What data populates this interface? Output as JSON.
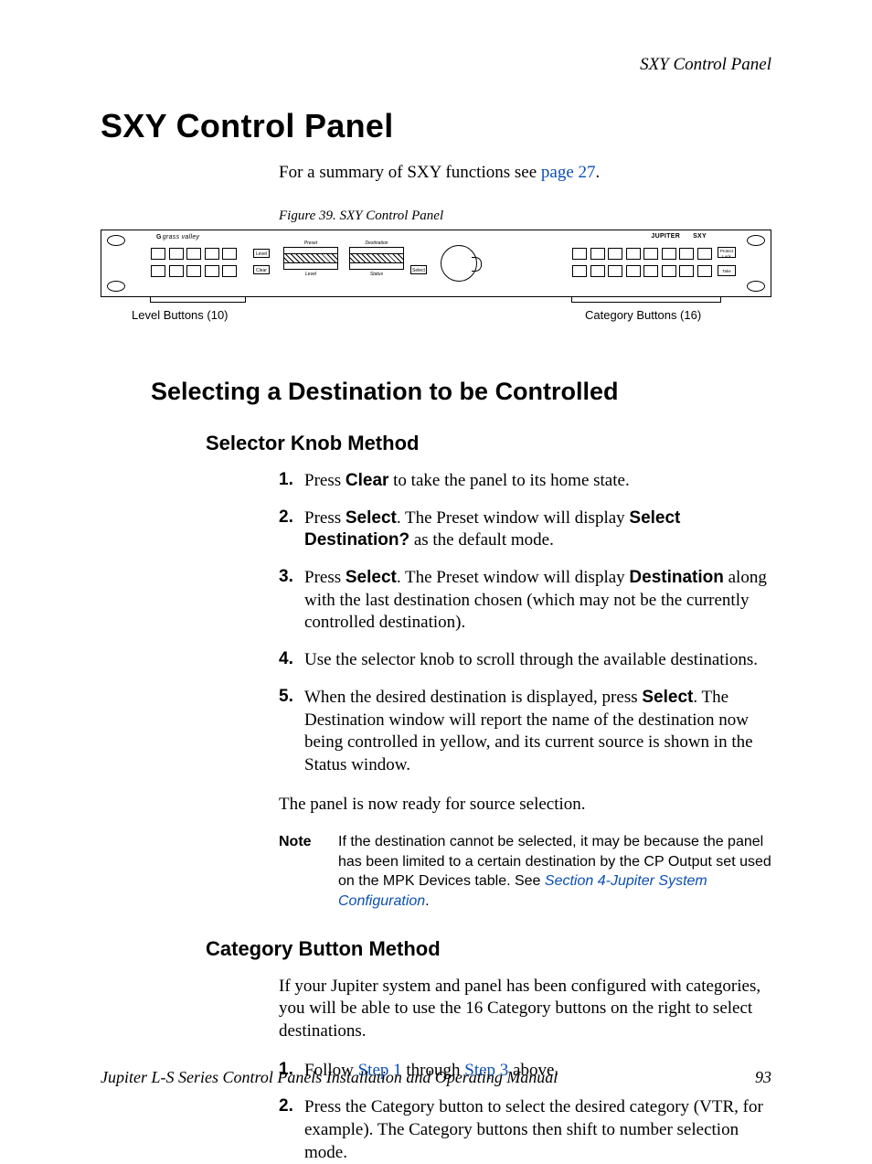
{
  "running_head": "SXY Control Panel",
  "title": "SXY Control Panel",
  "intro_before": "For a summary of SXY functions see ",
  "intro_link": "page 27",
  "intro_after": ".",
  "figure_caption": "Figure 39.  SXY Control Panel",
  "panel": {
    "logo": "grass valley",
    "brand1": "JUPITER",
    "brand2": "SXY",
    "level_btn": "Level",
    "clear_btn": "Clear",
    "select_btn": "Select",
    "preset_label_top": "Preset",
    "dest_label_top": "Destination",
    "preset_label_bot": "Level",
    "dest_label_bot": "Status",
    "protect_btn": "Protect Lock",
    "take_btn": "Take"
  },
  "callout_left": "Level Buttons (10)",
  "callout_right": "Category Buttons (16)",
  "h2": "Selecting a Destination to be Controlled",
  "h3a": "Selector Knob Method",
  "steps_a": [
    {
      "n": "1.",
      "pre": "Press ",
      "bold": "Clear",
      "post": " to take the panel to its home state."
    },
    {
      "n": "2.",
      "pre": "Press ",
      "bold": "Select",
      "mid": ". The Preset window will display ",
      "bold2": "Select Destination?",
      "post": " as the default mode."
    },
    {
      "n": "3.",
      "pre": "Press ",
      "bold": "Select",
      "mid": ". The Preset window will display ",
      "bold2": "Destination",
      "post": " along with the last destination chosen (which may not be the currently controlled destination)."
    },
    {
      "n": "4.",
      "pre": "Use the selector knob to scroll through the available destinations.",
      "bold": "",
      "post": ""
    },
    {
      "n": "5.",
      "pre": "When the desired destination is displayed, press ",
      "bold": "Select",
      "post": ". The Destination window will report the name of the destination now being controlled in yellow, and its current source is shown in the Status window."
    }
  ],
  "ready": "The panel is now ready for source selection.",
  "note_label": "Note",
  "note_text_before": "If the destination cannot be selected, it may be because the panel has been limited to a certain destination by the CP Output set used on the MPK Devices table. See ",
  "note_link": "Section 4-Jupiter System Configuration",
  "note_text_after": ".",
  "h3b": "Category Button Method",
  "cat_intro": "If your Jupiter system and panel has been configured with categories, you will be able to use the 16 Category buttons on the right to select destinations.",
  "steps_b": [
    {
      "n": "1.",
      "pre": "Follow ",
      "link1": "Step 1",
      "mid": " through ",
      "link2": "Step 3",
      "post": " above."
    },
    {
      "n": "2.",
      "pre": "Press the Category button to select the desired category (VTR, for example). The Category buttons then shift to number selection mode."
    }
  ],
  "footer_left": "Jupiter L-S Series Control Panels Installation and Operating Manual",
  "footer_right": "93"
}
